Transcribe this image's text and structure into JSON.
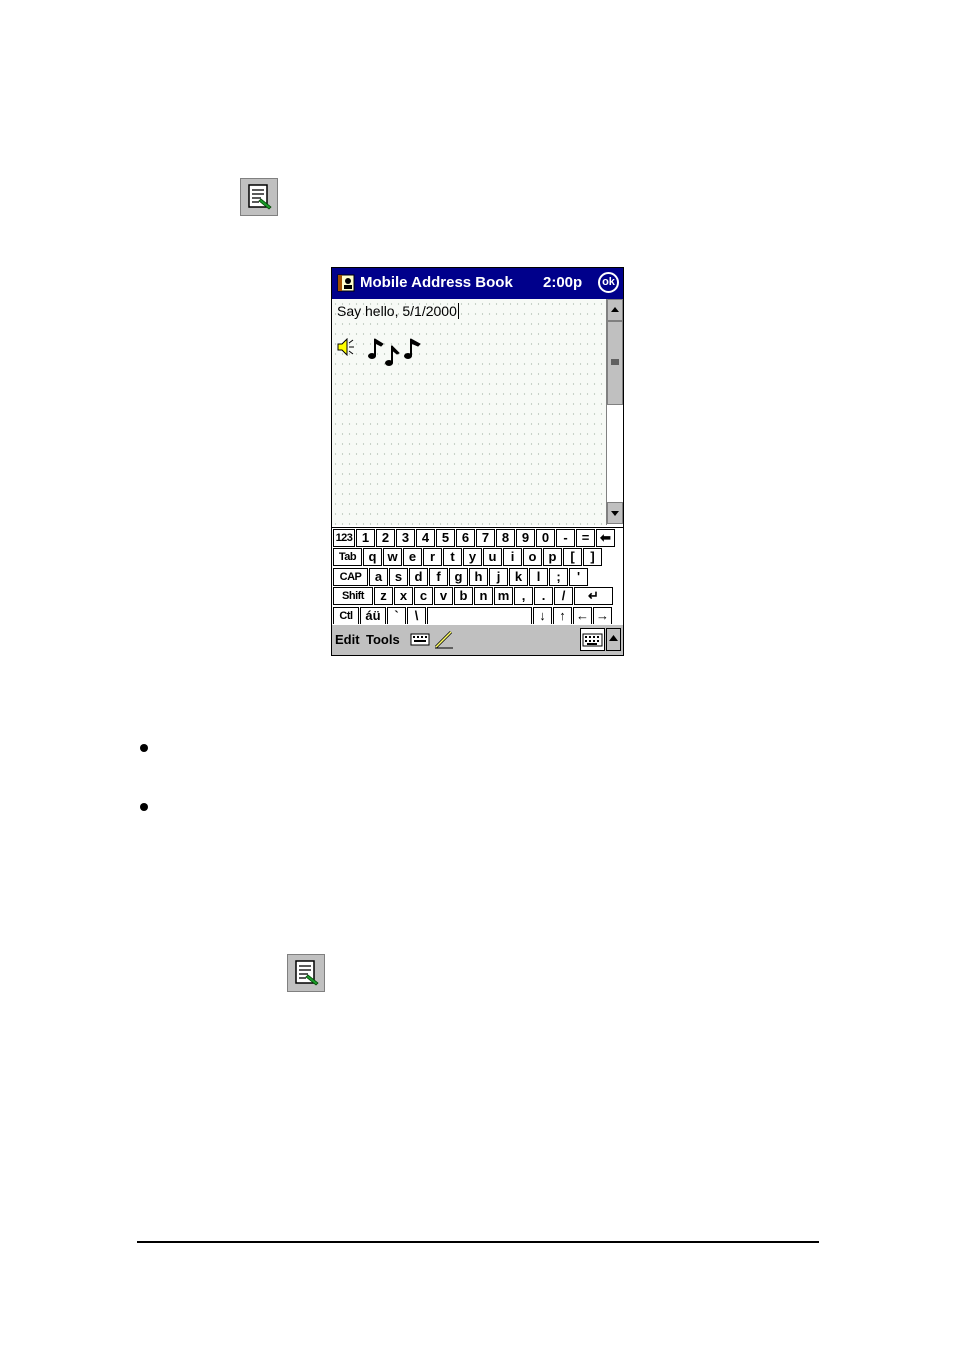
{
  "app": {
    "title": "Mobile Address Book",
    "time": "2:00p",
    "ok_label": "ok"
  },
  "note": {
    "text": "Say hello, 5/1/2000"
  },
  "keyboard": {
    "rows": [
      [
        "123",
        "1",
        "2",
        "3",
        "4",
        "5",
        "6",
        "7",
        "8",
        "9",
        "0",
        "-",
        "=",
        "⬅"
      ],
      [
        "Tab",
        "q",
        "w",
        "e",
        "r",
        "t",
        "y",
        "u",
        "i",
        "o",
        "p",
        "[",
        "]"
      ],
      [
        "CAP",
        "a",
        "s",
        "d",
        "f",
        "g",
        "h",
        "j",
        "k",
        "l",
        ";",
        "'"
      ],
      [
        "Shift",
        "z",
        "x",
        "c",
        "v",
        "b",
        "n",
        "m",
        ",",
        ".",
        "/",
        "↵"
      ],
      [
        "Ctl",
        "áü",
        "`",
        "\\",
        "",
        "↓",
        "↑",
        "←",
        "→"
      ]
    ]
  },
  "menubar": {
    "edit": "Edit",
    "tools": "Tools"
  },
  "colors": {
    "titlebar": "#00008b",
    "menubar": "#c0c0c0"
  }
}
